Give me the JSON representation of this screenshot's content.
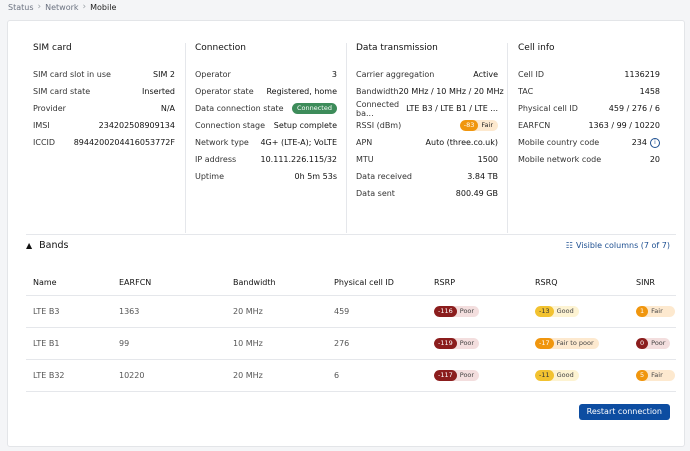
{
  "breadcrumb": {
    "items": [
      "Status",
      "Network",
      "Mobile"
    ]
  },
  "sim": {
    "title": "SIM card",
    "rows": [
      {
        "label": "SIM card slot in use",
        "value": "SIM 2"
      },
      {
        "label": "SIM card state",
        "value": "Inserted"
      },
      {
        "label": "Provider",
        "value": "N/A"
      },
      {
        "label": "IMSI",
        "value": "234202508909134"
      },
      {
        "label": "ICCID",
        "value": "8944200204416053772F"
      }
    ]
  },
  "connection": {
    "title": "Connection",
    "rows": [
      {
        "label": "Operator",
        "value": "3"
      },
      {
        "label": "Operator state",
        "value": "Registered, home"
      },
      {
        "label": "Data connection state",
        "value": "Connected"
      },
      {
        "label": "Connection stage",
        "value": "Setup complete"
      },
      {
        "label": "Network type",
        "value": "4G+ (LTE-A); VoLTE"
      },
      {
        "label": "IP address",
        "value": "10.111.226.115/32"
      },
      {
        "label": "Uptime",
        "value": "0h 5m 53s"
      }
    ],
    "connected_color": "#3d8c5a"
  },
  "transmission": {
    "title": "Data transmission",
    "rows": [
      {
        "label": "Carrier aggregation",
        "value": "Active"
      },
      {
        "label": "Bandwidth",
        "value": "20 MHz / 10 MHz / 20 MHz"
      },
      {
        "label": "Connected ba...",
        "value": "LTE B3 / LTE B1 / LTE ..."
      },
      {
        "label": "RSSI (dBm)",
        "value": "-83",
        "quality": "Fair"
      },
      {
        "label": "APN",
        "value": "Auto (three.co.uk)"
      },
      {
        "label": "MTU",
        "value": "1500"
      },
      {
        "label": "Data received",
        "value": "3.84 TB"
      },
      {
        "label": "Data sent",
        "value": "800.49 GB"
      }
    ]
  },
  "cell": {
    "title": "Cell info",
    "rows": [
      {
        "label": "Cell ID",
        "value": "1136219"
      },
      {
        "label": "TAC",
        "value": "1458"
      },
      {
        "label": "Physical cell ID",
        "value": "459 / 276 / 6"
      },
      {
        "label": "EARFCN",
        "value": "1363 / 99 / 10220"
      },
      {
        "label": "Mobile country code",
        "value": "234"
      },
      {
        "label": "Mobile network code",
        "value": "20"
      }
    ]
  },
  "bands": {
    "title": "Bands",
    "visible_columns": "Visible columns (7 of 7)",
    "columns": [
      "Name",
      "EARFCN",
      "Bandwidth",
      "Physical cell ID",
      "RSRP",
      "RSRQ",
      "SINR"
    ],
    "rows": [
      {
        "name": "LTE B3",
        "earfcn": "1363",
        "bandwidth": "20 MHz",
        "pci": "459",
        "rsrp": {
          "v": "-116",
          "q": "Poor",
          "c": "#8b1d1d",
          "bg": "#f3dede"
        },
        "rsrq": {
          "v": "-13",
          "q": "Good",
          "c": "#f2c230",
          "bg": "#fdf3d2"
        },
        "sinr": {
          "v": "1",
          "q": "Fair to poor",
          "c": "#f0960e",
          "bg": "#fde9cf"
        }
      },
      {
        "name": "LTE B1",
        "earfcn": "99",
        "bandwidth": "10 MHz",
        "pci": "276",
        "rsrp": {
          "v": "-119",
          "q": "Poor",
          "c": "#8b1d1d",
          "bg": "#f3dede"
        },
        "rsrq": {
          "v": "-17",
          "q": "Fair to poor",
          "c": "#f0960e",
          "bg": "#fde9cf"
        },
        "sinr": {
          "v": "0",
          "q": "Poor",
          "c": "#8b1d1d",
          "bg": "#f3dede"
        }
      },
      {
        "name": "LTE B32",
        "earfcn": "10220",
        "bandwidth": "20 MHz",
        "pci": "6",
        "rsrp": {
          "v": "-117",
          "q": "Poor",
          "c": "#8b1d1d",
          "bg": "#f3dede"
        },
        "rsrq": {
          "v": "-11",
          "q": "Good",
          "c": "#f2c230",
          "bg": "#fdf3d2"
        },
        "sinr": {
          "v": "5",
          "q": "Fair to poor",
          "c": "#f0960e",
          "bg": "#fde9cf"
        }
      }
    ]
  },
  "restart_label": "Restart connection",
  "rssi_colors": {
    "c": "#f0960e",
    "bg": "#fde9cf"
  }
}
